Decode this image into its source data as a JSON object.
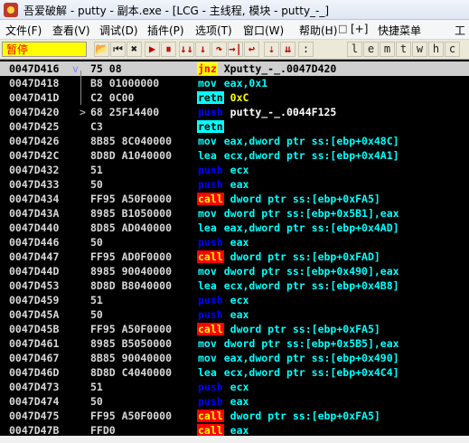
{
  "window": {
    "title": "吾爱破解 - putty - 副本.exe - [LCG - 主线程, 模块 - putty_-_]"
  },
  "menu": {
    "items": [
      "文件(F)",
      "查看(V)",
      "调试(D)",
      "插件(P)",
      "选项(T)",
      "窗口(W)",
      "帮助(H)",
      "[+]",
      "快捷菜单",
      "工"
    ],
    "controls": [
      "_",
      "□",
      "×"
    ]
  },
  "toolbar": {
    "status": "暂停",
    "buttons": [
      "⏮",
      "✖",
      "▶",
      "⏸",
      "↓↓",
      "↓",
      "↷",
      "→|",
      "↩",
      ":",
      "l",
      "e",
      "m",
      "t",
      "w",
      "h",
      "c"
    ],
    "icons": [
      "open-icon",
      "rewind-icon",
      "close-icon",
      "run-icon",
      "pause-icon",
      "trace-into-icon",
      "step-into-icon",
      "step-over-icon",
      "execute-till-return-icon",
      "go-to-icon",
      "goto-separator-icon"
    ]
  },
  "disassembly": [
    {
      "addr": "0047D416",
      "marker": "",
      "bytes": "75 08",
      "mn": "jnz",
      "ops": "Xputty_-_.0047D420",
      "kind": "jnz",
      "sel": true,
      "arrow": "v"
    },
    {
      "addr": "0047D418",
      "marker": "",
      "bytes": "B8 01000000",
      "mn": "mov",
      "ops": "eax,0x1",
      "kind": "mov"
    },
    {
      "addr": "0047D41D",
      "marker": "",
      "bytes": "C2 0C00",
      "mn": "retn",
      "ops": "0xC",
      "kind": "retn"
    },
    {
      "addr": "0047D420",
      "marker": ">",
      "bytes": "68 25F14400",
      "mn": "push",
      "ops": "putty_-_.0044F125",
      "kind": "pushw"
    },
    {
      "addr": "0047D425",
      "marker": "",
      "bytes": "C3",
      "mn": "retn",
      "ops": "",
      "kind": "retn"
    },
    {
      "addr": "0047D426",
      "marker": "",
      "bytes": "8B85 8C040000",
      "mn": "mov",
      "ops": "eax,dword ptr ss:[ebp+0x48C]",
      "kind": "mov"
    },
    {
      "addr": "0047D42C",
      "marker": "",
      "bytes": "8D8D A1040000",
      "mn": "lea",
      "ops": "ecx,dword ptr ss:[ebp+0x4A1]",
      "kind": "lea"
    },
    {
      "addr": "0047D432",
      "marker": "",
      "bytes": "51",
      "mn": "push",
      "ops": "ecx",
      "kind": "push"
    },
    {
      "addr": "0047D433",
      "marker": "",
      "bytes": "50",
      "mn": "push",
      "ops": "eax",
      "kind": "push"
    },
    {
      "addr": "0047D434",
      "marker": "",
      "bytes": "FF95 A50F0000",
      "mn": "call",
      "ops": "dword ptr ss:[ebp+0xFA5]",
      "kind": "call"
    },
    {
      "addr": "0047D43A",
      "marker": "",
      "bytes": "8985 B1050000",
      "mn": "mov",
      "ops": "dword ptr ss:[ebp+0x5B1],eax",
      "kind": "mov"
    },
    {
      "addr": "0047D440",
      "marker": "",
      "bytes": "8D85 AD040000",
      "mn": "lea",
      "ops": "eax,dword ptr ss:[ebp+0x4AD]",
      "kind": "lea"
    },
    {
      "addr": "0047D446",
      "marker": "",
      "bytes": "50",
      "mn": "push",
      "ops": "eax",
      "kind": "push"
    },
    {
      "addr": "0047D447",
      "marker": "",
      "bytes": "FF95 AD0F0000",
      "mn": "call",
      "ops": "dword ptr ss:[ebp+0xFAD]",
      "kind": "call"
    },
    {
      "addr": "0047D44D",
      "marker": "",
      "bytes": "8985 90040000",
      "mn": "mov",
      "ops": "dword ptr ss:[ebp+0x490],eax",
      "kind": "mov"
    },
    {
      "addr": "0047D453",
      "marker": "",
      "bytes": "8D8D B8040000",
      "mn": "lea",
      "ops": "ecx,dword ptr ss:[ebp+0x4B8]",
      "kind": "lea"
    },
    {
      "addr": "0047D459",
      "marker": "",
      "bytes": "51",
      "mn": "push",
      "ops": "ecx",
      "kind": "push"
    },
    {
      "addr": "0047D45A",
      "marker": "",
      "bytes": "50",
      "mn": "push",
      "ops": "eax",
      "kind": "push"
    },
    {
      "addr": "0047D45B",
      "marker": "",
      "bytes": "FF95 A50F0000",
      "mn": "call",
      "ops": "dword ptr ss:[ebp+0xFA5]",
      "kind": "call"
    },
    {
      "addr": "0047D461",
      "marker": "",
      "bytes": "8985 B5050000",
      "mn": "mov",
      "ops": "dword ptr ss:[ebp+0x5B5],eax",
      "kind": "mov"
    },
    {
      "addr": "0047D467",
      "marker": "",
      "bytes": "8B85 90040000",
      "mn": "mov",
      "ops": "eax,dword ptr ss:[ebp+0x490]",
      "kind": "mov"
    },
    {
      "addr": "0047D46D",
      "marker": "",
      "bytes": "8D8D C4040000",
      "mn": "lea",
      "ops": "ecx,dword ptr ss:[ebp+0x4C4]",
      "kind": "lea"
    },
    {
      "addr": "0047D473",
      "marker": "",
      "bytes": "51",
      "mn": "push",
      "ops": "ecx",
      "kind": "push"
    },
    {
      "addr": "0047D474",
      "marker": "",
      "bytes": "50",
      "mn": "push",
      "ops": "eax",
      "kind": "push"
    },
    {
      "addr": "0047D475",
      "marker": "",
      "bytes": "FF95 A50F0000",
      "mn": "call",
      "ops": "dword ptr ss:[ebp+0xFA5]",
      "kind": "call"
    },
    {
      "addr": "0047D47B",
      "marker": "",
      "bytes": "FFD0",
      "mn": "call",
      "ops": "eax",
      "kind": "call"
    }
  ],
  "colors": {
    "background": "#000000",
    "status_bg": "#ffff00",
    "status_fg": "#ff0000",
    "selected_row": "#cfcfcf",
    "call_bg": "#ff0000",
    "jnz_bg": "#ffff00",
    "retn_bg": "#00ffff",
    "push_fg": "#0000ff",
    "mov_fg": "#00ffff"
  }
}
